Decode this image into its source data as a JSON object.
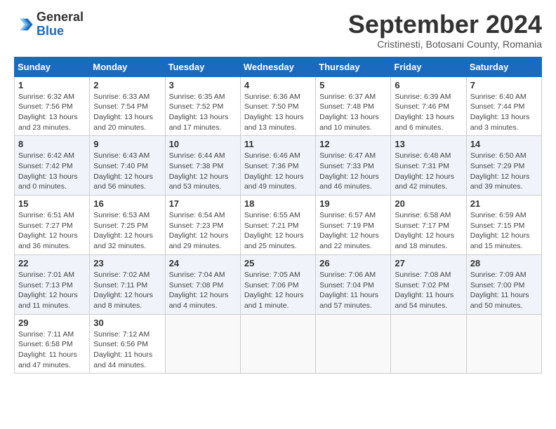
{
  "header": {
    "logo": {
      "line1": "General",
      "line2": "Blue"
    },
    "title": "September 2024",
    "subtitle": "Cristinesti, Botosani County, Romania"
  },
  "calendar": {
    "days_of_week": [
      "Sunday",
      "Monday",
      "Tuesday",
      "Wednesday",
      "Thursday",
      "Friday",
      "Saturday"
    ],
    "weeks": [
      [
        {
          "day": "",
          "info": ""
        },
        {
          "day": "2",
          "info": "Sunrise: 6:33 AM\nSunset: 7:54 PM\nDaylight: 13 hours\nand 20 minutes."
        },
        {
          "day": "3",
          "info": "Sunrise: 6:35 AM\nSunset: 7:52 PM\nDaylight: 13 hours\nand 17 minutes."
        },
        {
          "day": "4",
          "info": "Sunrise: 6:36 AM\nSunset: 7:50 PM\nDaylight: 13 hours\nand 13 minutes."
        },
        {
          "day": "5",
          "info": "Sunrise: 6:37 AM\nSunset: 7:48 PM\nDaylight: 13 hours\nand 10 minutes."
        },
        {
          "day": "6",
          "info": "Sunrise: 6:39 AM\nSunset: 7:46 PM\nDaylight: 13 hours\nand 6 minutes."
        },
        {
          "day": "7",
          "info": "Sunrise: 6:40 AM\nSunset: 7:44 PM\nDaylight: 13 hours\nand 3 minutes."
        }
      ],
      [
        {
          "day": "1",
          "info": "Sunrise: 6:32 AM\nSunset: 7:56 PM\nDaylight: 13 hours\nand 23 minutes.",
          "first": true
        },
        {
          "day": "8",
          "info": "Sunrise: 6:42 AM\nSunset: 7:42 PM\nDaylight: 13 hours\nand 0 minutes."
        },
        {
          "day": "9",
          "info": "Sunrise: 6:43 AM\nSunset: 7:40 PM\nDaylight: 12 hours\nand 56 minutes."
        },
        {
          "day": "10",
          "info": "Sunrise: 6:44 AM\nSunset: 7:38 PM\nDaylight: 12 hours\nand 53 minutes."
        },
        {
          "day": "11",
          "info": "Sunrise: 6:46 AM\nSunset: 7:36 PM\nDaylight: 12 hours\nand 49 minutes."
        },
        {
          "day": "12",
          "info": "Sunrise: 6:47 AM\nSunset: 7:33 PM\nDaylight: 12 hours\nand 46 minutes."
        },
        {
          "day": "13",
          "info": "Sunrise: 6:48 AM\nSunset: 7:31 PM\nDaylight: 12 hours\nand 42 minutes."
        },
        {
          "day": "14",
          "info": "Sunrise: 6:50 AM\nSunset: 7:29 PM\nDaylight: 12 hours\nand 39 minutes."
        }
      ],
      [
        {
          "day": "15",
          "info": "Sunrise: 6:51 AM\nSunset: 7:27 PM\nDaylight: 12 hours\nand 36 minutes."
        },
        {
          "day": "16",
          "info": "Sunrise: 6:53 AM\nSunset: 7:25 PM\nDaylight: 12 hours\nand 32 minutes."
        },
        {
          "day": "17",
          "info": "Sunrise: 6:54 AM\nSunset: 7:23 PM\nDaylight: 12 hours\nand 29 minutes."
        },
        {
          "day": "18",
          "info": "Sunrise: 6:55 AM\nSunset: 7:21 PM\nDaylight: 12 hours\nand 25 minutes."
        },
        {
          "day": "19",
          "info": "Sunrise: 6:57 AM\nSunset: 7:19 PM\nDaylight: 12 hours\nand 22 minutes."
        },
        {
          "day": "20",
          "info": "Sunrise: 6:58 AM\nSunset: 7:17 PM\nDaylight: 12 hours\nand 18 minutes."
        },
        {
          "day": "21",
          "info": "Sunrise: 6:59 AM\nSunset: 7:15 PM\nDaylight: 12 hours\nand 15 minutes."
        }
      ],
      [
        {
          "day": "22",
          "info": "Sunrise: 7:01 AM\nSunset: 7:13 PM\nDaylight: 12 hours\nand 11 minutes."
        },
        {
          "day": "23",
          "info": "Sunrise: 7:02 AM\nSunset: 7:11 PM\nDaylight: 12 hours\nand 8 minutes."
        },
        {
          "day": "24",
          "info": "Sunrise: 7:04 AM\nSunset: 7:08 PM\nDaylight: 12 hours\nand 4 minutes."
        },
        {
          "day": "25",
          "info": "Sunrise: 7:05 AM\nSunset: 7:06 PM\nDaylight: 12 hours\nand 1 minute."
        },
        {
          "day": "26",
          "info": "Sunrise: 7:06 AM\nSunset: 7:04 PM\nDaylight: 11 hours\nand 57 minutes."
        },
        {
          "day": "27",
          "info": "Sunrise: 7:08 AM\nSunset: 7:02 PM\nDaylight: 11 hours\nand 54 minutes."
        },
        {
          "day": "28",
          "info": "Sunrise: 7:09 AM\nSunset: 7:00 PM\nDaylight: 11 hours\nand 50 minutes."
        }
      ],
      [
        {
          "day": "29",
          "info": "Sunrise: 7:11 AM\nSunset: 6:58 PM\nDaylight: 11 hours\nand 47 minutes."
        },
        {
          "day": "30",
          "info": "Sunrise: 7:12 AM\nSunset: 6:56 PM\nDaylight: 11 hours\nand 44 minutes."
        },
        {
          "day": "",
          "info": ""
        },
        {
          "day": "",
          "info": ""
        },
        {
          "day": "",
          "info": ""
        },
        {
          "day": "",
          "info": ""
        },
        {
          "day": "",
          "info": ""
        }
      ]
    ]
  }
}
